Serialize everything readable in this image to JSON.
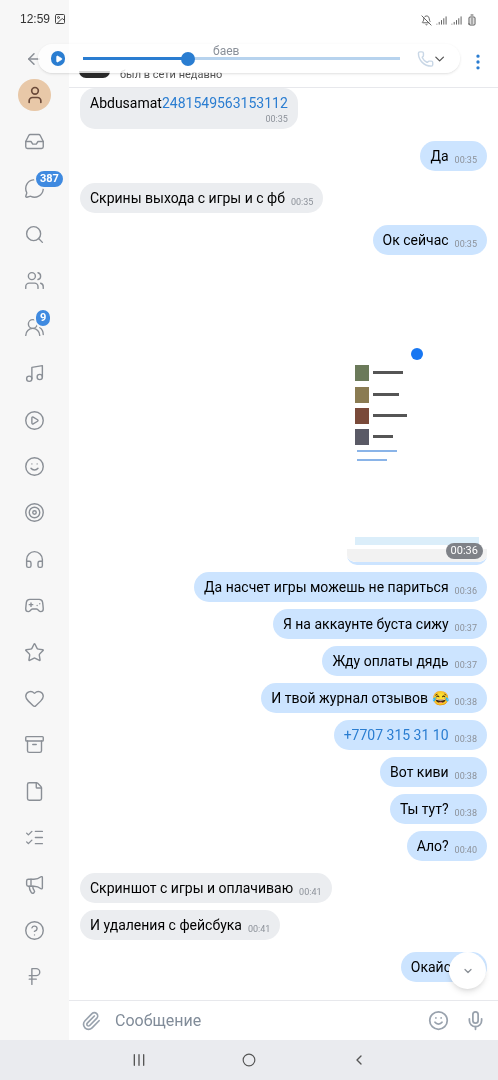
{
  "status_bar": {
    "time": "12:59"
  },
  "header": {
    "name": "баев",
    "status": "был в сети недавно"
  },
  "player": {
    "level": 0.33
  },
  "sidebar": {
    "items": [
      {
        "kind": "inbox"
      },
      {
        "kind": "chat",
        "badge": "387"
      },
      {
        "kind": "search"
      },
      {
        "kind": "people"
      },
      {
        "kind": "group",
        "badge": "9"
      },
      {
        "kind": "music"
      },
      {
        "kind": "video"
      },
      {
        "kind": "smiley"
      },
      {
        "kind": "target"
      },
      {
        "kind": "headphones"
      },
      {
        "kind": "gamepad"
      },
      {
        "kind": "star"
      },
      {
        "kind": "heart"
      },
      {
        "kind": "archive"
      },
      {
        "kind": "file"
      },
      {
        "kind": "list"
      },
      {
        "kind": "megaphone"
      },
      {
        "kind": "help"
      },
      {
        "kind": "ruble"
      }
    ]
  },
  "messages": [
    {
      "kind": "text",
      "outgoing": false,
      "parts": [
        {
          "text": "Abdusamat",
          "link": false
        },
        {
          "text": "2481549563153112",
          "link": true
        }
      ],
      "time": "00:35",
      "stacked": true
    },
    {
      "kind": "text",
      "outgoing": true,
      "parts": [
        {
          "text": "Да",
          "link": false
        }
      ],
      "time": "00:35"
    },
    {
      "kind": "text",
      "outgoing": false,
      "parts": [
        {
          "text": "Скрины выхода с игры и с фб",
          "link": false
        }
      ],
      "time": "00:35"
    },
    {
      "kind": "text",
      "outgoing": true,
      "parts": [
        {
          "text": "Ок сейчас",
          "link": false
        }
      ],
      "time": "00:35"
    },
    {
      "outgoing": true,
      "time": "00:36"
    },
    {
      "kind": "text",
      "outgoing": true,
      "parts": [
        {
          "text": "Да насчет игры можешь не париться",
          "link": false
        }
      ],
      "time": "00:36"
    },
    {
      "kind": "text",
      "outgoing": true,
      "parts": [
        {
          "text": "Я на аккаунте буста сижу",
          "link": false
        }
      ],
      "time": "00:37"
    },
    {
      "kind": "text",
      "outgoing": true,
      "parts": [
        {
          "text": "Жду оплаты дядь",
          "link": false
        }
      ],
      "time": "00:37"
    },
    {
      "kind": "text",
      "outgoing": true,
      "parts": [
        {
          "text": "И твой журнал отзывов 😂",
          "link": false
        }
      ],
      "time": "00:38"
    },
    {
      "kind": "text",
      "outgoing": true,
      "parts": [
        {
          "text": "+7707 315 31 10",
          "link": true
        }
      ],
      "time": "00:38"
    },
    {
      "kind": "text",
      "outgoing": true,
      "parts": [
        {
          "text": "Вот киви",
          "link": false
        }
      ],
      "time": "00:38"
    },
    {
      "kind": "text",
      "outgoing": true,
      "parts": [
        {
          "text": "Ты тут?",
          "link": false
        }
      ],
      "time": "00:38"
    },
    {
      "kind": "text",
      "outgoing": true,
      "parts": [
        {
          "text": "Ало?",
          "link": false
        }
      ],
      "time": "00:40"
    },
    {
      "kind": "text",
      "outgoing": false,
      "parts": [
        {
          "text": "Скриншот с игры и оплачиваю",
          "link": false
        }
      ],
      "time": "00:41"
    },
    {
      "kind": "text",
      "outgoing": false,
      "parts": [
        {
          "text": "И удаления с фейсбука",
          "link": false
        }
      ],
      "time": "00:41"
    },
    {
      "kind": "text",
      "outgoing": true,
      "parts": [
        {
          "text": "Окайс",
          "link": false
        }
      ]
    }
  ],
  "composer": {
    "placeholder": "Сообщение"
  }
}
